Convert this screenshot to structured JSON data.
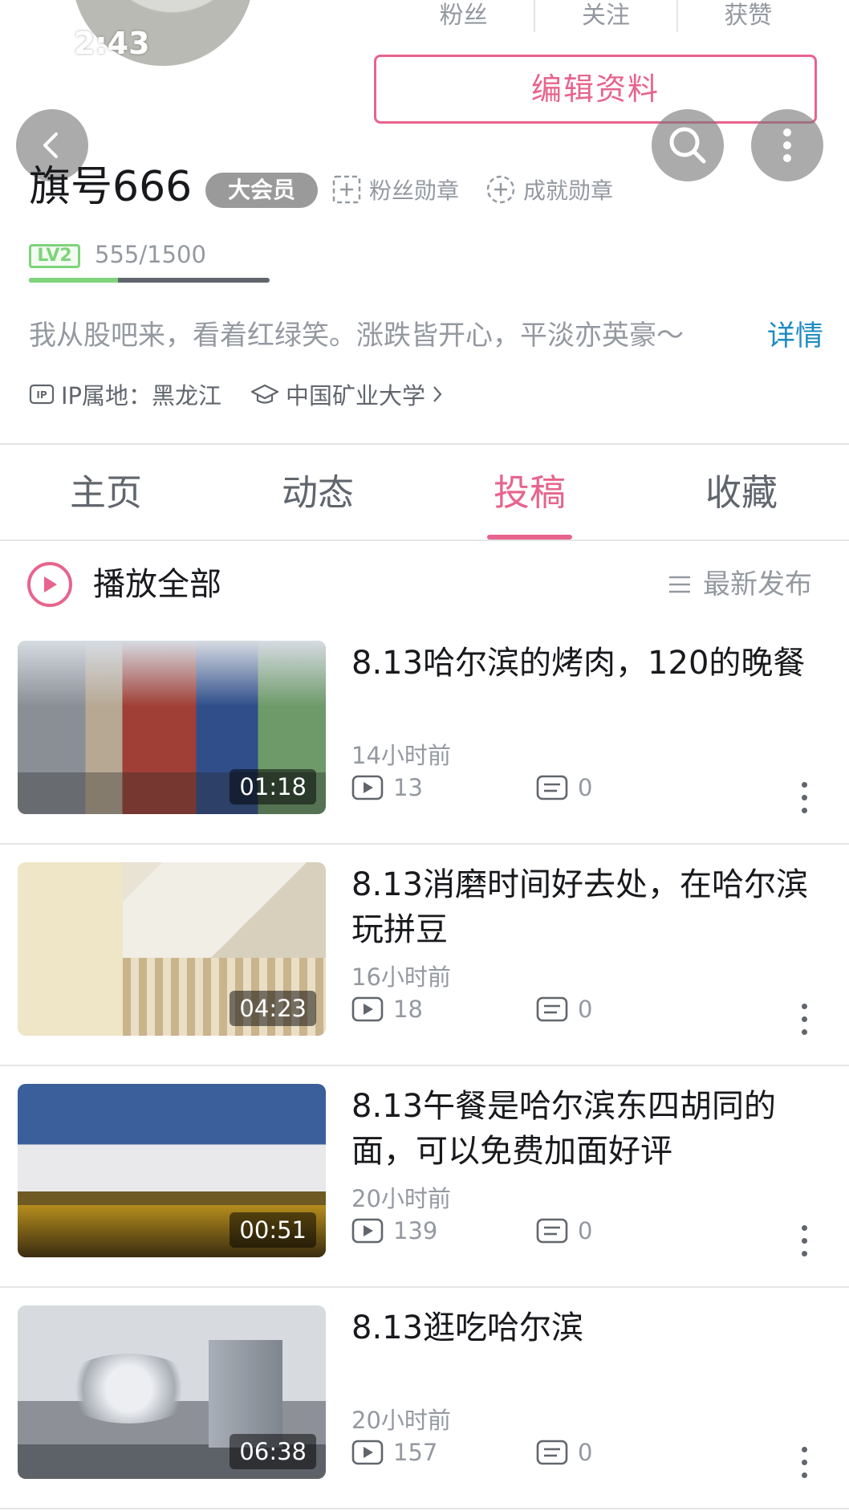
{
  "status_bar": {
    "time": "2:43"
  },
  "profile": {
    "stats": [
      {
        "label": "粉丝"
      },
      {
        "label": "关注"
      },
      {
        "label": "获赞"
      }
    ],
    "edit_button": "编辑资料",
    "username": "旗号666",
    "vip_badge": "大会员",
    "medals": [
      "粉丝勋章",
      "成就勋章"
    ],
    "level": {
      "badge": "LV2",
      "exp_text": "555/1500",
      "progress": 0.37
    },
    "bio": "我从股吧来，看着红绿笑。涨跌皆开心，平淡亦英豪～",
    "detail_link": "详情",
    "ip_location": "IP属地：黑龙江",
    "school": "中国矿业大学"
  },
  "tabs": [
    {
      "label": "主页",
      "active": false
    },
    {
      "label": "动态",
      "active": false
    },
    {
      "label": "投稿",
      "active": true
    },
    {
      "label": "收藏",
      "active": false
    }
  ],
  "list_header": {
    "play_all": "播放全部",
    "sort": "最新发布"
  },
  "videos": [
    {
      "title": "8.13哈尔滨的烤肉，120的晚餐",
      "time": "14小时前",
      "views": "13",
      "comments": "0",
      "duration": "01:18"
    },
    {
      "title": "8.13消磨时间好去处，在哈尔滨玩拼豆",
      "time": "16小时前",
      "views": "18",
      "comments": "0",
      "duration": "04:23"
    },
    {
      "title": "8.13午餐是哈尔滨东四胡同的面，可以免费加面好评",
      "time": "20小时前",
      "views": "139",
      "comments": "0",
      "duration": "00:51"
    },
    {
      "title": "8.13逛吃哈尔滨",
      "time": "20小时前",
      "views": "157",
      "comments": "0",
      "duration": "06:38"
    }
  ],
  "colors": {
    "accent": "#e7648d",
    "link": "#1e8bc3",
    "level": "#7ed37b"
  },
  "icons": [
    "back-arrow-icon",
    "search-icon",
    "more-vertical-icon",
    "medal-plus-icon",
    "play-circle-icon",
    "sort-lines-icon",
    "play-count-icon",
    "comment-icon",
    "ip-icon",
    "graduation-cap-icon"
  ]
}
